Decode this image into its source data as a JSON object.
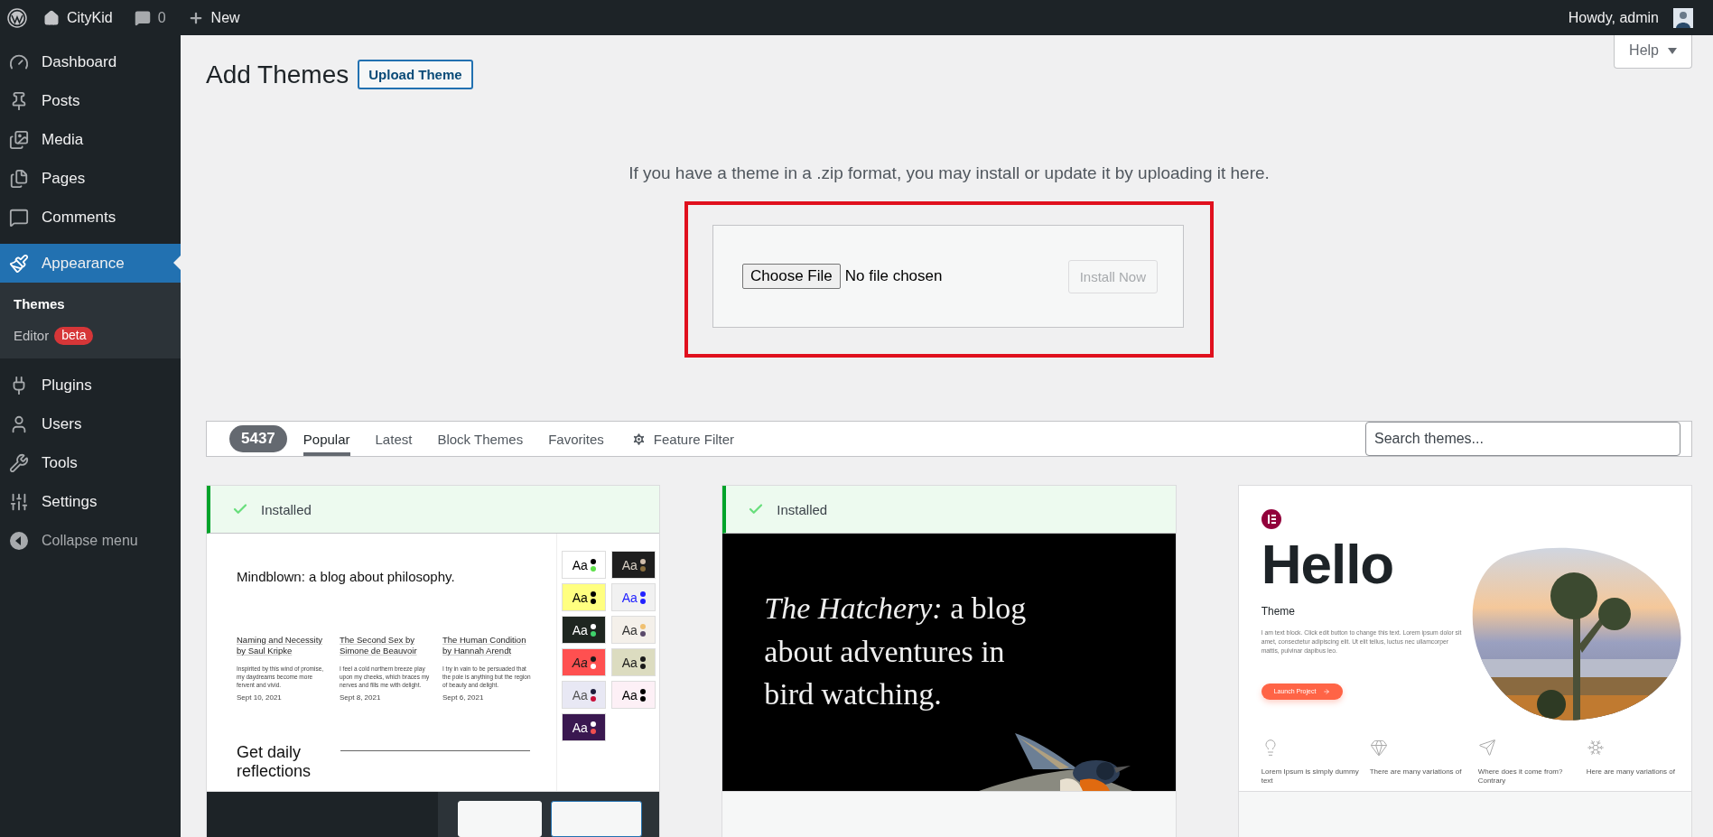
{
  "admin_bar": {
    "site_name": "CityKid",
    "comments_count": "0",
    "new_label": "New",
    "greeting": "Howdy, admin"
  },
  "sidebar": {
    "items": [
      {
        "label": "Dashboard",
        "selected": false
      },
      {
        "label": "Posts",
        "selected": false
      },
      {
        "label": "Media",
        "selected": false
      },
      {
        "label": "Pages",
        "selected": false
      },
      {
        "label": "Comments",
        "selected": false
      },
      {
        "label": "Appearance",
        "selected": true,
        "children": [
          {
            "label": "Themes",
            "selected": true
          },
          {
            "label": "Editor",
            "badge": "beta",
            "selected": false
          }
        ]
      },
      {
        "label": "Plugins",
        "selected": false
      },
      {
        "label": "Users",
        "selected": false
      },
      {
        "label": "Tools",
        "selected": false
      },
      {
        "label": "Settings",
        "selected": false
      }
    ],
    "collapse_label": "Collapse menu"
  },
  "help_button": "Help",
  "page_title": "Add Themes",
  "upload_button": "Upload Theme",
  "upload": {
    "instructions": "If you have a theme in a .zip format, you may install or update it by uploading it here.",
    "choose_button": "Choose File",
    "file_status": "No file chosen",
    "install_button": "Install Now",
    "install_disabled": true,
    "highlighted": true
  },
  "filter_bar": {
    "count": "5437",
    "tabs": [
      {
        "label": "Popular",
        "selected": true
      },
      {
        "label": "Latest",
        "selected": false
      },
      {
        "label": "Block Themes",
        "selected": false
      },
      {
        "label": "Favorites",
        "selected": false
      }
    ],
    "feature_filter": "Feature Filter",
    "search_placeholder": "Search themes..."
  },
  "themes": [
    {
      "kind": "blog",
      "installed": true,
      "installed_label": "Installed",
      "actions_visible": true,
      "headline": "Mindblown: a blog about philosophy.",
      "posts": [
        {
          "title": "Naming and Necessity by Saul Kripke",
          "excerpt": "Inspirited by this wind of promise, my daydreams become more fervent and vivid.",
          "date": "Sept 10, 2021"
        },
        {
          "title": "The Second Sex by Simone de Beauvoir",
          "excerpt": "I feel a cold northern breeze play upon my cheeks, which braces my nerves and fills me with delight.",
          "date": "Sept 8, 2021"
        },
        {
          "title": "The Human Condition by Hannah Arendt",
          "excerpt": "I try in vain to be persuaded that the pole is anything but the region of beauty and delight.",
          "date": "Sept 6, 2021"
        }
      ],
      "signup_heading": "Get daily reflections",
      "styles": [
        {
          "label": "Aa",
          "color": "#ffffff",
          "italic": false
        },
        {
          "label": "Aa",
          "color": "#1e1e1e",
          "italic": false
        },
        {
          "label": "Aa",
          "color": "#ffff80",
          "italic": false
        },
        {
          "label": "Aa",
          "color": "#f1f1f1",
          "italic": false
        },
        {
          "label": "Aa",
          "color": "#1e2620",
          "italic": false
        },
        {
          "label": "Aa",
          "color": "#f4f0ea",
          "italic": false
        },
        {
          "label": "Aa",
          "color": "#ff5050",
          "italic": true
        },
        {
          "label": "Aa",
          "color": "#dcdcc0",
          "italic": false
        },
        {
          "label": "Aa",
          "color": "#e8e8f4",
          "italic": false
        },
        {
          "label": "Aa",
          "color": "#fdf0f6",
          "italic": false
        },
        {
          "label": "Aa",
          "color": "#3a1850",
          "italic": false
        }
      ]
    },
    {
      "kind": "hatchery",
      "installed": true,
      "installed_label": "Installed",
      "actions_visible": false,
      "headline": "*The Hatchery:* a blog about adventures in bird watching."
    },
    {
      "kind": "hello",
      "installed": false,
      "actions_visible": false,
      "headline": "Hello",
      "subtitle": "Theme",
      "body": "I am text block. Click edit button to change this text. Lorem ipsum dolor sit amet, consectetur adipiscing elit. Ut elit tellus, luctus nec ullamcorper mattis, pulvinar dapibus leo.",
      "cta": "Launch Project",
      "features": [
        "Lorem Ipsum is simply dummy text",
        "There are many variations of",
        "Where does it come from? Contrary",
        "Here are many variations of"
      ]
    }
  ]
}
